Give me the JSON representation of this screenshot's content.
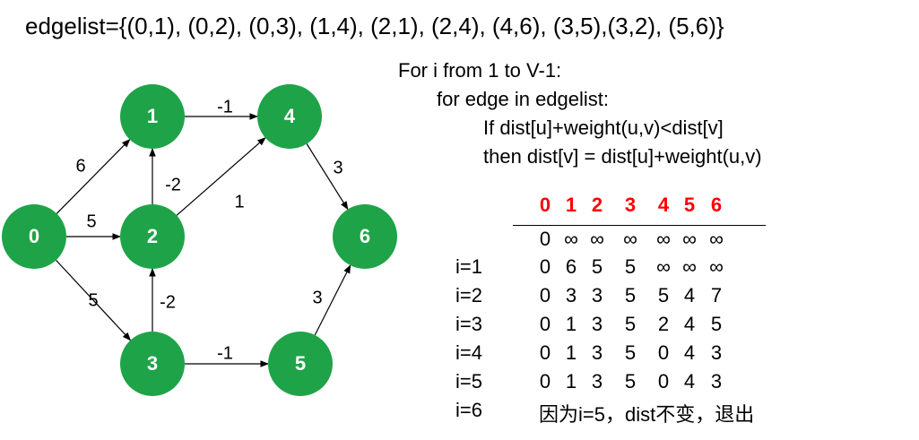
{
  "edgelist_text": "edgelist={(0,1), (0,2), (0,3), (1,4), (2,1), (2,4), (4,6), (3,5),(3,2), (5,6)}",
  "code_lines": [
    "For  i from 1 to V-1:",
    "for edge in edgelist:",
    "If dist[u]+weight(u,v)<dist[v]",
    "then dist[v] = dist[u]+weight(u,v)"
  ],
  "graph": {
    "node_color": "#1fa348",
    "nodes": [
      {
        "id": "0",
        "label": "0"
      },
      {
        "id": "1",
        "label": "1"
      },
      {
        "id": "2",
        "label": "2"
      },
      {
        "id": "3",
        "label": "3"
      },
      {
        "id": "4",
        "label": "4"
      },
      {
        "id": "5",
        "label": "5"
      },
      {
        "id": "6",
        "label": "6"
      }
    ],
    "edges": [
      {
        "from": "0",
        "to": "1",
        "weight": "6"
      },
      {
        "from": "0",
        "to": "2",
        "weight": "5"
      },
      {
        "from": "0",
        "to": "3",
        "weight": "5"
      },
      {
        "from": "1",
        "to": "4",
        "weight": "-1"
      },
      {
        "from": "2",
        "to": "1",
        "weight": "-2"
      },
      {
        "from": "2",
        "to": "4",
        "weight": "1"
      },
      {
        "from": "4",
        "to": "6",
        "weight": "3"
      },
      {
        "from": "3",
        "to": "5",
        "weight": "-1"
      },
      {
        "from": "3",
        "to": "2",
        "weight": "-2"
      },
      {
        "from": "5",
        "to": "6",
        "weight": "3"
      }
    ]
  },
  "table": {
    "header_color": "#ff0000",
    "headers": [
      "0",
      "1",
      "2",
      "3",
      "4",
      "5",
      "6"
    ],
    "rows": [
      {
        "label": "",
        "values": [
          "0",
          "∞",
          "∞",
          "∞",
          "∞",
          "∞",
          "∞"
        ]
      },
      {
        "label": "i=1",
        "values": [
          "0",
          "6",
          "5",
          "5",
          "∞",
          "∞",
          "∞"
        ]
      },
      {
        "label": "i=2",
        "values": [
          "0",
          "3",
          "3",
          "5",
          "5",
          "4",
          "7"
        ]
      },
      {
        "label": "i=3",
        "values": [
          "0",
          "1",
          "3",
          "5",
          "2",
          "4",
          "5"
        ]
      },
      {
        "label": "i=4",
        "values": [
          "0",
          "1",
          "3",
          "5",
          "0",
          "4",
          "3"
        ]
      },
      {
        "label": "i=5",
        "values": [
          "0",
          "1",
          "3",
          "5",
          "0",
          "4",
          "3"
        ]
      }
    ],
    "final_row": {
      "label": "i=6",
      "note": "因为i=5，dist不变，退出"
    }
  }
}
